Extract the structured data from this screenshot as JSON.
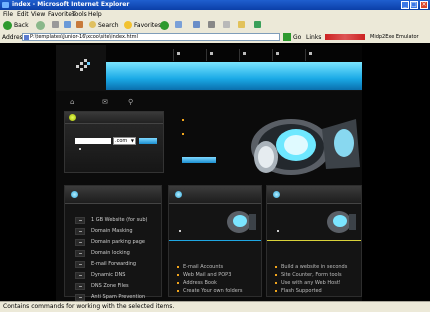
{
  "window": {
    "title": "index - Microsoft Internet Explorer",
    "min_glyph": "_",
    "max_glyph": "□",
    "close_glyph": "×"
  },
  "menu": [
    "File",
    "Edit",
    "View",
    "Favorites",
    "Tools",
    "Help"
  ],
  "toolbar": {
    "back_label": "Back",
    "search_label": "Search",
    "favorites_label": "Favorites"
  },
  "address": {
    "label": "Address",
    "value": "P:\\templates\\Junior-16\\xcoo\\site\\index.html",
    "go_label": "Go",
    "links_label": "Links",
    "emulator_label": "Midp2Exe Emulator"
  },
  "status": {
    "text": "Contains commands for working with the selected items."
  },
  "site": {
    "login": {
      "select_value": ".com"
    },
    "col1": {
      "items": [
        "1 GB Website (for sub)",
        "Domain Masking",
        "Domain parking page",
        "Domain locking",
        "E-mail Forwarding",
        "Dynamic DNS",
        "DNS Zone Files",
        "Anti Spam Prevention"
      ]
    },
    "col2": {
      "items": [
        "E-mail Accounts",
        "Web Mail and POP3",
        "Address Book",
        "Create Your own folders"
      ]
    },
    "col3": {
      "items": [
        "Build a website in seconds",
        "Site Counter, Form tools",
        "Use with any Web Host!",
        "Flash Supported"
      ]
    }
  }
}
